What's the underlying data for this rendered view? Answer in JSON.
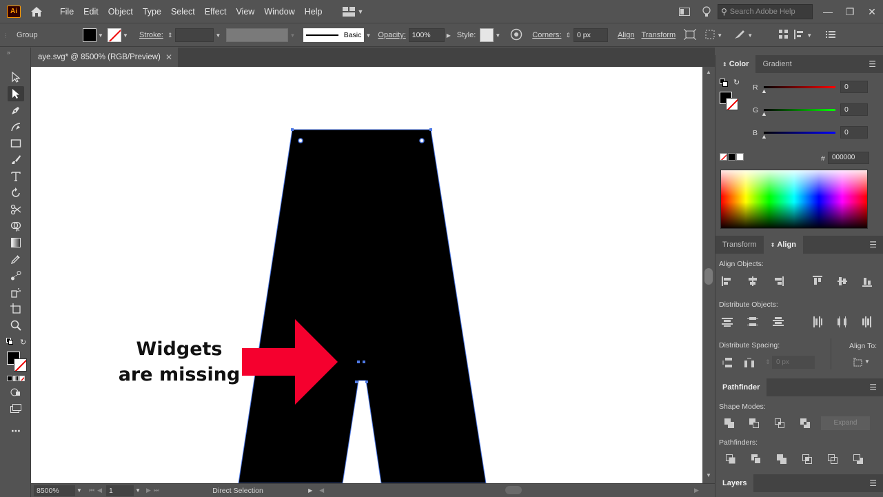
{
  "app": {
    "logo": "Ai"
  },
  "menu": [
    "File",
    "Edit",
    "Object",
    "Type",
    "Select",
    "Effect",
    "View",
    "Window",
    "Help"
  ],
  "search": {
    "placeholder": "Search Adobe Help"
  },
  "control": {
    "selection_type": "Group",
    "stroke_label": "Stroke:",
    "brush_label": "Basic",
    "opacity_label": "Opacity:",
    "opacity_value": "100%",
    "style_label": "Style:",
    "corners_label": "Corners:",
    "corners_value": "0 px",
    "align_label": "Align",
    "transform_label": "Transform"
  },
  "document": {
    "tab_title": "aye.svg* @ 8500% (RGB/Preview)"
  },
  "annotation": {
    "line1": "Widgets",
    "line2": "are missing"
  },
  "status": {
    "zoom": "8500%",
    "artboard": "1",
    "tool_name": "Direct Selection"
  },
  "color_panel": {
    "tabs": [
      "Color",
      "Gradient"
    ],
    "r_label": "R",
    "g_label": "G",
    "b_label": "B",
    "r_value": "0",
    "g_value": "0",
    "b_value": "0",
    "hex_symbol": "#",
    "hex_value": "000000"
  },
  "align_panel": {
    "tabs": [
      "Transform",
      "Align"
    ],
    "align_objects": "Align Objects:",
    "distribute_objects": "Distribute Objects:",
    "distribute_spacing": "Distribute Spacing:",
    "align_to": "Align To:",
    "spacing_value": "0 px"
  },
  "pathfinder_panel": {
    "title": "Pathfinder",
    "shape_modes": "Shape Modes:",
    "expand": "Expand",
    "pathfinders": "Pathfinders:"
  },
  "layers_panel": {
    "title": "Layers"
  },
  "colors": {
    "accent_arrow": "#f5002e",
    "selection": "#4f7ae6",
    "ui_bg": "#535353"
  }
}
